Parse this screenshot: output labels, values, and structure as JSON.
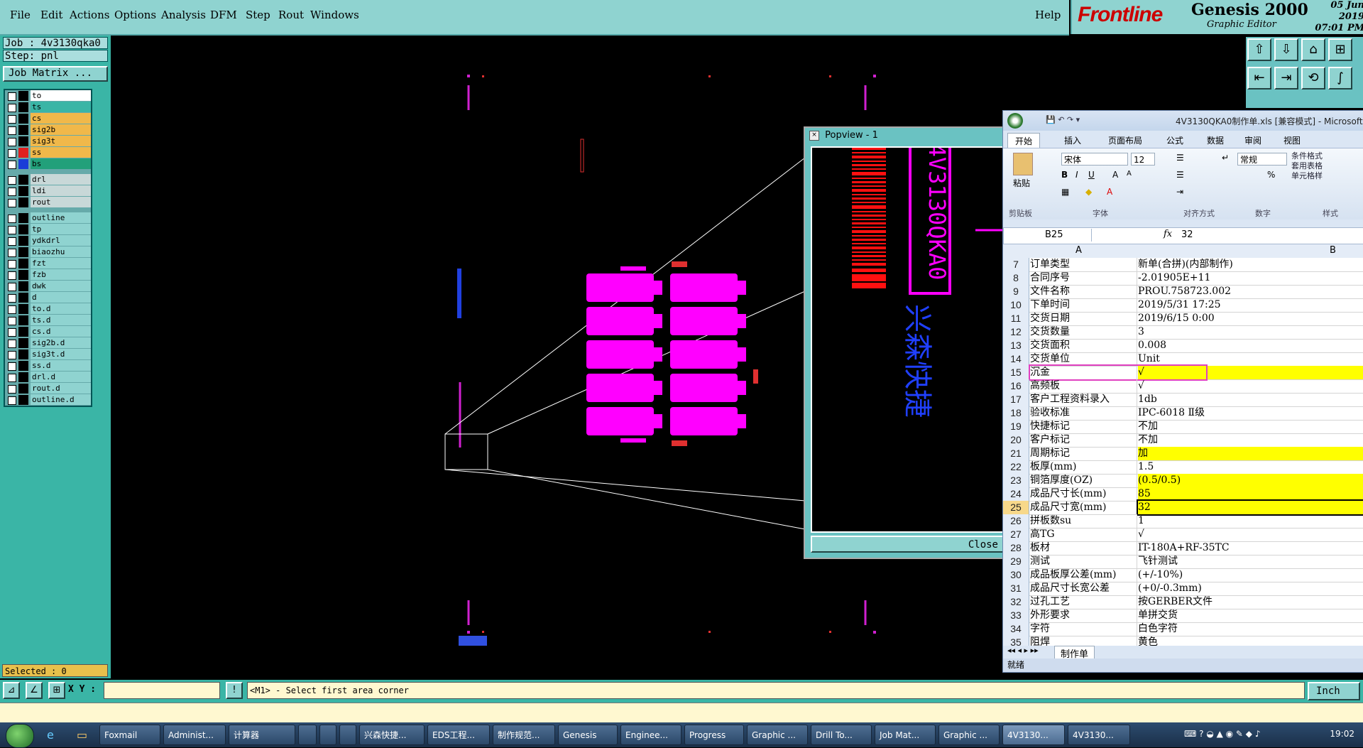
{
  "menu": {
    "items": [
      "File",
      "Edit",
      "Actions",
      "Options",
      "Analysis",
      "DFM",
      "Step",
      "Rout",
      "Windows"
    ],
    "help": "Help"
  },
  "brand": {
    "logo": "Frontline",
    "title": "Genesis 2000",
    "subtitle": "Graphic Editor",
    "date": "05 Jun 2019",
    "time": "07:01 PM"
  },
  "job": {
    "job_line": "Job : 4v3130qka0",
    "step_line": "Step: pnl",
    "matrix_button": "Job Matrix ..."
  },
  "layers": [
    {
      "name": "to",
      "swatch": "#000000",
      "bg": "#ffffff"
    },
    {
      "name": "ts",
      "swatch": "#000000",
      "bg": "#3ab5a6"
    },
    {
      "name": "cs",
      "swatch": "#000000",
      "bg": "#f0b84a"
    },
    {
      "name": "sig2b",
      "swatch": "#000000",
      "bg": "#f0b84a"
    },
    {
      "name": "sig3t",
      "swatch": "#000000",
      "bg": "#f0b84a"
    },
    {
      "name": "ss",
      "swatch": "#e02020",
      "bg": "#f0b84a"
    },
    {
      "name": "bs",
      "swatch": "#1a3dd8",
      "bg": "#22a07a"
    },
    {
      "sep": true
    },
    {
      "name": "drl",
      "swatch": "#000000",
      "bg": "#c8d8d8"
    },
    {
      "name": "ldi",
      "swatch": "#000000",
      "bg": "#c8d8d8"
    },
    {
      "name": "rout",
      "swatch": "#000000",
      "bg": "#c8d8d8"
    },
    {
      "sep": true
    },
    {
      "name": "outline",
      "swatch": "#000000",
      "bg": "#8fd3d0"
    },
    {
      "name": "tp",
      "swatch": "#000000",
      "bg": "#8fd3d0"
    },
    {
      "name": "ydkdrl",
      "swatch": "#000000",
      "bg": "#8fd3d0"
    },
    {
      "name": "biaozhu",
      "swatch": "#000000",
      "bg": "#8fd3d0"
    },
    {
      "name": "fzt",
      "swatch": "#000000",
      "bg": "#8fd3d0"
    },
    {
      "name": "fzb",
      "swatch": "#000000",
      "bg": "#8fd3d0"
    },
    {
      "name": "dwk",
      "swatch": "#000000",
      "bg": "#8fd3d0"
    },
    {
      "name": "d",
      "swatch": "#000000",
      "bg": "#8fd3d0"
    },
    {
      "name": "to.d",
      "swatch": "#000000",
      "bg": "#8fd3d0"
    },
    {
      "name": "ts.d",
      "swatch": "#000000",
      "bg": "#8fd3d0"
    },
    {
      "name": "cs.d",
      "swatch": "#000000",
      "bg": "#8fd3d0"
    },
    {
      "name": "sig2b.d",
      "swatch": "#000000",
      "bg": "#8fd3d0"
    },
    {
      "name": "sig3t.d",
      "swatch": "#000000",
      "bg": "#8fd3d0"
    },
    {
      "name": "ss.d",
      "swatch": "#000000",
      "bg": "#8fd3d0"
    },
    {
      "name": "drl.d",
      "swatch": "#000000",
      "bg": "#8fd3d0"
    },
    {
      "name": "rout.d",
      "swatch": "#000000",
      "bg": "#8fd3d0"
    },
    {
      "name": "outline.d",
      "swatch": "#000000",
      "bg": "#8fd3d0"
    }
  ],
  "selected": "Selected : 0",
  "popview": {
    "title": "Popview - 1",
    "close": "Close",
    "text1": "4V3130QKA0",
    "text2": "兴森快捷"
  },
  "command": {
    "xy_label": "X Y :",
    "prompt": "<M1> - Select first area corner",
    "unit": "Inch"
  },
  "excel": {
    "title": "4V3130QKA0制作单.xls [兼容模式] - Microsoft",
    "tabs": [
      "开始",
      "插入",
      "页面布局",
      "公式",
      "数据",
      "审阅",
      "视图"
    ],
    "font_name": "宋体",
    "font_size": "12",
    "number_format": "常规",
    "groups": [
      "剪贴板",
      "字体",
      "对齐方式",
      "数字",
      "样式"
    ],
    "paste_label": "粘贴",
    "side_labels": [
      "条件格式",
      "套用表格",
      "单元格样"
    ],
    "name_box": "B25",
    "formula": "32",
    "col_a": "A",
    "col_b": "B",
    "rows": [
      {
        "n": "7",
        "a": "订单类型",
        "b": "新单(合拼)(内部制作)"
      },
      {
        "n": "8",
        "a": "合同序号",
        "b": "-2.01905E+11"
      },
      {
        "n": "9",
        "a": "文件名称",
        "b": "PROU.758723.002"
      },
      {
        "n": "10",
        "a": "下单时间",
        "b": "2019/5/31 17:25"
      },
      {
        "n": "11",
        "a": "交货日期",
        "b": "2019/6/15 0:00"
      },
      {
        "n": "12",
        "a": "交货数量",
        "b": "3"
      },
      {
        "n": "13",
        "a": "交货面积",
        "b": "0.008"
      },
      {
        "n": "14",
        "a": "交货单位",
        "b": "Unit"
      },
      {
        "n": "15",
        "a": "沉金",
        "b": "√",
        "hl": true
      },
      {
        "n": "16",
        "a": "高频板",
        "b": "√"
      },
      {
        "n": "17",
        "a": "客户工程资料录入",
        "b": "1db"
      },
      {
        "n": "18",
        "a": "验收标准",
        "b": "IPC-6018 Ⅱ级"
      },
      {
        "n": "19",
        "a": "快捷标记",
        "b": "不加"
      },
      {
        "n": "20",
        "a": "客户标记",
        "b": "不加"
      },
      {
        "n": "21",
        "a": "周期标记",
        "b": "加",
        "hl": true
      },
      {
        "n": "22",
        "a": "板厚(mm)",
        "b": "1.5"
      },
      {
        "n": "23",
        "a": "铜箔厚度(OZ)",
        "b": " (0.5/0.5)",
        "hl": true
      },
      {
        "n": "24",
        "a": "成品尺寸长(mm)",
        "b": "85",
        "hl": true
      },
      {
        "n": "25",
        "a": "成品尺寸宽(mm)",
        "b": "32",
        "hl": true,
        "sel": true
      },
      {
        "n": "26",
        "a": "拼板数su",
        "b": "1"
      },
      {
        "n": "27",
        "a": "高TG",
        "b": "√"
      },
      {
        "n": "28",
        "a": "板材",
        "b": "IT-180A+RF-35TC"
      },
      {
        "n": "29",
        "a": "测试",
        "b": "飞针测试"
      },
      {
        "n": "30",
        "a": "成品板厚公差(mm)",
        "b": "(+/-10%)"
      },
      {
        "n": "31",
        "a": "成品尺寸长宽公差",
        "b": "(+0/-0.3mm)"
      },
      {
        "n": "32",
        "a": "过孔工艺",
        "b": "按GERBER文件"
      },
      {
        "n": "33",
        "a": "外形要求",
        "b": "单拼交货"
      },
      {
        "n": "34",
        "a": "字符",
        "b": "白色字符"
      },
      {
        "n": "35",
        "a": "阻焊",
        "b": "黄色"
      }
    ],
    "sheet_tab": "制作单",
    "status": "就绪"
  },
  "taskbar": {
    "items": [
      "Foxmail",
      "Administ...",
      "计算器",
      "",
      "",
      "",
      "兴森快捷...",
      "EDS工程...",
      "制作规范...",
      "Genesis",
      "Enginee...",
      "Progress",
      "Graphic ...",
      "Drill To...",
      "Job Mat...",
      "Graphic ...",
      "4V3130...",
      "4V3130..."
    ],
    "clock": "19:02"
  }
}
